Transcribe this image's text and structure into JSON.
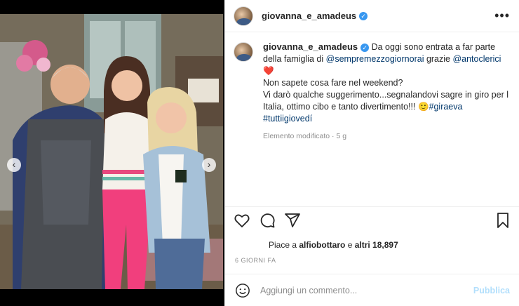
{
  "post": {
    "username": "giovanna_e_amadeus",
    "verified_icon": "verified-badge-icon",
    "more_icon": "more-options-icon"
  },
  "caption": {
    "username": "giovanna_e_amadeus",
    "line1_before": "Da oggi sono entrata a far parte della famiglia di ",
    "mention1": "@sempremezzogiornorai",
    "between": " grazie ",
    "mention2": "@antoclerici",
    "heart": "❤️",
    "line2": "Non sapete cosa fare nel weekend?",
    "line3": "Vi darò qualche suggerimento...segnalandovi sagre in giro per l Italia, ottimo cibo e tanto divertimento!!! 🙂",
    "hashtag1": "#giraeva",
    "hashtag2": "#tuttiigiovedí",
    "edited": "Elemento modificato",
    "age": "5 g"
  },
  "likes": {
    "prefix": "Piace a ",
    "user": "alfiobottaro",
    "middle": " e ",
    "others": "altri 18,897"
  },
  "date": "6 GIORNI FA",
  "comment": {
    "placeholder": "Aggiungi un commento...",
    "publish": "Pubblica"
  },
  "carousel": {
    "prev": "‹",
    "next": "›",
    "count": 2,
    "active": 1
  },
  "colors": {
    "accent": "#3897f0",
    "mention": "#00376b",
    "heart": "#ed4956",
    "publish_disabled": "#b2dffc"
  }
}
